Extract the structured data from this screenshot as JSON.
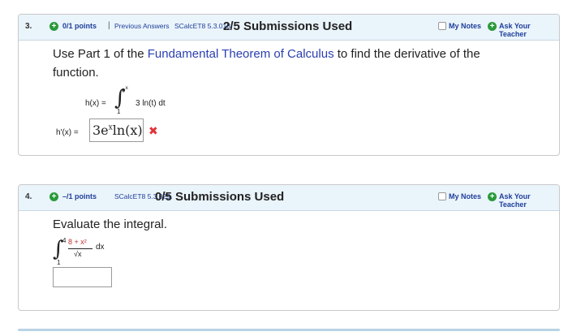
{
  "q3": {
    "number": "3.",
    "points": "0/1 points",
    "separator": "|",
    "previous_answers": "Previous Answers",
    "problem_id": "SCalcET8 5.3.013.",
    "submissions": "2/5 Submissions Used",
    "my_notes": "My Notes",
    "ask_teacher": "Ask Your Teacher",
    "prompt_before": "Use Part 1 of the ",
    "prompt_link": "Fundamental Theorem of Calculus",
    "prompt_after": " to find the derivative of the",
    "prompt_line2": "function.",
    "function_lhs": "h(x) =",
    "upper_limit": "e",
    "upper_limit_exp": "x",
    "lower_limit": "1",
    "integrand": "3 ln(t) dt",
    "derivative_lhs": "h'(x) =",
    "answer": "3e",
    "answer_exp": "x",
    "answer_tail": "ln(x)",
    "status_mark": "✖"
  },
  "q4": {
    "number": "4.",
    "points": "–/1 points",
    "problem_id": "SCalcET8 5.3.029.",
    "submissions": "0/5 Submissions Used",
    "my_notes": "My Notes",
    "ask_teacher": "Ask Your Teacher",
    "prompt": "Evaluate the integral.",
    "upper_limit": "4",
    "lower_limit": "1",
    "numerator": "8 + x²",
    "denominator": "√x",
    "differential": "dx",
    "answer_value": ""
  },
  "colors": {
    "header_bg": "#eaf4fb",
    "link_blue": "#2a3fb0",
    "status_green": "#2a9a3a",
    "error_red": "#e0333a"
  }
}
